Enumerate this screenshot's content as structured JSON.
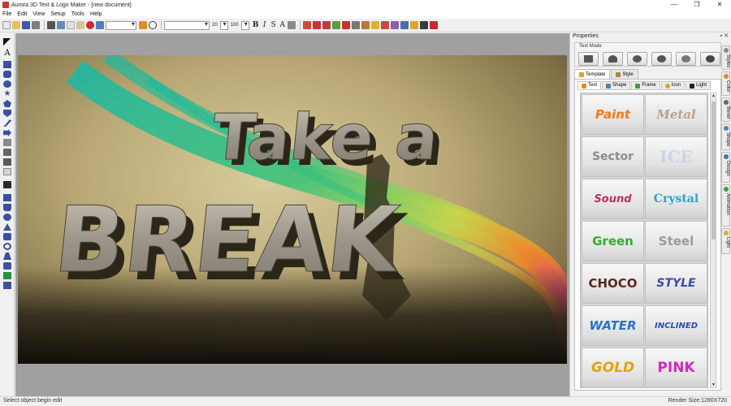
{
  "window": {
    "title": "Aurora 3D Text & Logo Maker - [new document]",
    "controls": [
      "—",
      "❐",
      "✕"
    ]
  },
  "menu": [
    "File",
    "Edit",
    "View",
    "Setup",
    "Tools",
    "Help"
  ],
  "toolbar": {
    "size_value": "20",
    "zoom_value": "100",
    "style_letters": [
      "B",
      "I",
      "S",
      "A"
    ]
  },
  "canvas": {
    "line1": "Take a",
    "line2": "BREAK",
    "accent_colors": [
      "#1fb7a0",
      "#3ec27a",
      "#c7d84a",
      "#f08a2a",
      "#d23a7a"
    ]
  },
  "properties": {
    "title": "Properties",
    "pin_icons": "▪ ✕",
    "text_mode_label": "Text Mode",
    "top_tabs": [
      "Template",
      "Style"
    ],
    "sub_tabs": [
      "Text",
      "Shape",
      "Frame",
      "Icon",
      "Light"
    ],
    "templates": [
      {
        "label": "Paint",
        "color": "#f07a1c"
      },
      {
        "label": "Metal",
        "color": "#b8a28f"
      },
      {
        "label": "Sector",
        "color": "#8c8c8c"
      },
      {
        "label": "ICE",
        "color": "#c9d4e6"
      },
      {
        "label": "Sound",
        "color": "#c2305a"
      },
      {
        "label": "Crystal",
        "color": "#2aa4c8"
      },
      {
        "label": "Green",
        "color": "#2fae2f"
      },
      {
        "label": "Steel",
        "color": "#9a9a9a"
      },
      {
        "label": "CHOCO",
        "color": "#5a2a1c"
      },
      {
        "label": "STYLE",
        "color": "#3a4ba8"
      },
      {
        "label": "WATER",
        "color": "#2a72c8"
      },
      {
        "label": "INCLINED",
        "color": "#2a4fb2"
      },
      {
        "label": "GOLD",
        "color": "#e0a410"
      },
      {
        "label": "PINK",
        "color": "#d02abd"
      }
    ],
    "side_tabs": [
      "Styles",
      "Color",
      "Bevel",
      "Shape",
      "Design",
      "Animation",
      "Light"
    ]
  },
  "status": {
    "left": "Select object begin edit",
    "right": "Render Size:1280X720"
  }
}
